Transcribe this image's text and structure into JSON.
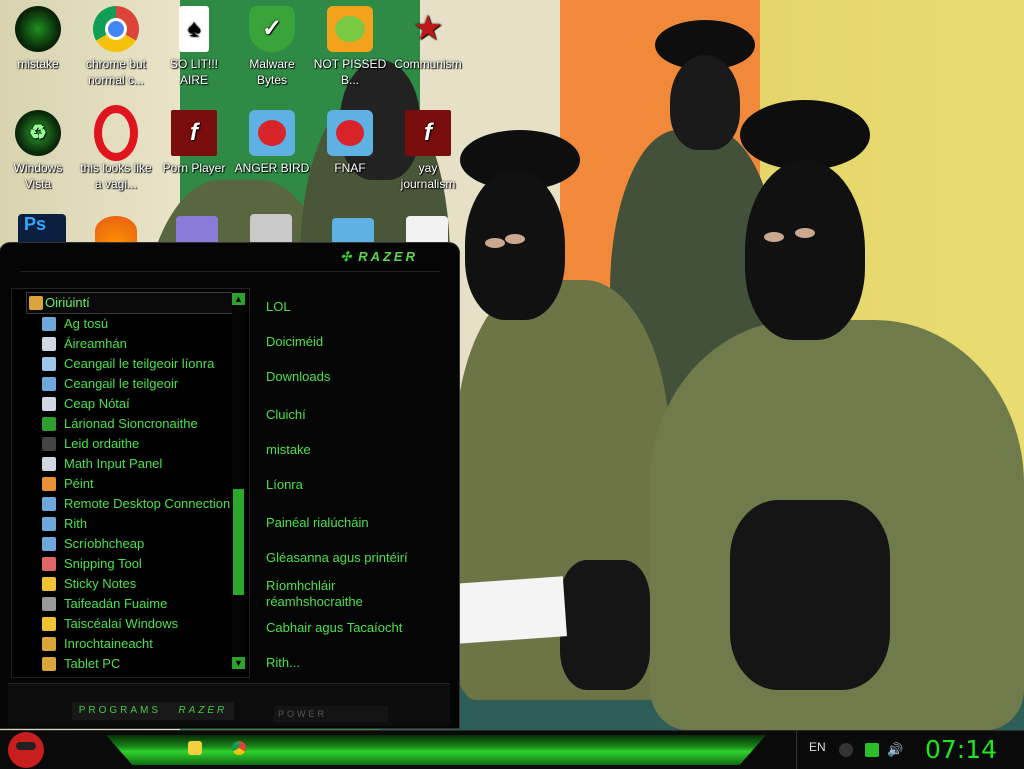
{
  "desktop": {
    "icons": [
      {
        "label": "mistake",
        "icon": "razer-logo-icon"
      },
      {
        "label": "chrome but normal c...",
        "icon": "chrome-icon"
      },
      {
        "label": "SO LIT!!! AIRE",
        "icon": "solitaire-icon"
      },
      {
        "label": "Malware Bytes",
        "icon": "shield-check-icon"
      },
      {
        "label": "NOT PISSED B...",
        "icon": "angry-birds-pig-icon"
      },
      {
        "label": "Communism",
        "icon": "red-star-icon"
      },
      {
        "label": "Windows Vista",
        "icon": "recycle-icon"
      },
      {
        "label": "this looks like a vagi...",
        "icon": "opera-icon"
      },
      {
        "label": "Porn Player",
        "icon": "flash-player-icon"
      },
      {
        "label": "ANGER BIRD",
        "icon": "angry-birds-icon"
      },
      {
        "label": "FNAF",
        "icon": "angry-birds-icon"
      },
      {
        "label": "yay journalism",
        "icon": "flash-player-icon"
      }
    ]
  },
  "start_menu": {
    "brand": "RAZER",
    "programs": [
      {
        "label": "Oiriúintí",
        "folder": true
      },
      {
        "label": "Ag tosú"
      },
      {
        "label": "Áireamhán"
      },
      {
        "label": "Ceangail le teilgeoir líonra"
      },
      {
        "label": "Ceangail le teilgeoir"
      },
      {
        "label": "Ceap Nótaí"
      },
      {
        "label": "Lárionad Sioncronaithe"
      },
      {
        "label": "Leid ordaithe"
      },
      {
        "label": "Math Input Panel"
      },
      {
        "label": "Péint"
      },
      {
        "label": "Remote Desktop Connection"
      },
      {
        "label": "Rith"
      },
      {
        "label": "Scríobhcheap"
      },
      {
        "label": "Snipping Tool"
      },
      {
        "label": "Sticky Notes"
      },
      {
        "label": "Taifeadán Fuaime"
      },
      {
        "label": "Taiscéalaí Windows"
      },
      {
        "label": "Inrochtaineacht"
      },
      {
        "label": "Tablet PC"
      }
    ],
    "places": [
      "LOL",
      "Doiciméid",
      "Downloads",
      "Cluichí",
      "mistake",
      "Líonra",
      "Painéal rialúcháin",
      "Gléasanna agus printéirí",
      "Ríomhchláir réamhshocraithe",
      "Cabhair agus Tacaíocht",
      "Rith..."
    ],
    "programs_button": "PROGRAMS",
    "programs_brand": "RAZER",
    "power_button": "POWER"
  },
  "taskbar": {
    "language": "EN",
    "time": "07:14"
  },
  "colors": {
    "accent_green": "#3ce83c",
    "menu_bg": "#050505"
  }
}
